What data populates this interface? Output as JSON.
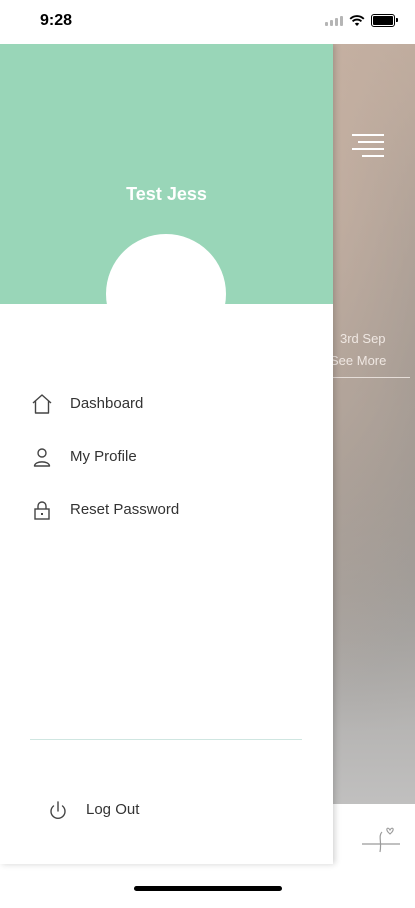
{
  "status_bar": {
    "time": "9:28"
  },
  "drawer": {
    "user_name": "Test Jess",
    "menu_items": [
      {
        "label": "Dashboard",
        "icon": "home-icon"
      },
      {
        "label": "My Profile",
        "icon": "user-icon"
      },
      {
        "label": "Reset Password",
        "icon": "lock-icon"
      }
    ],
    "logout_label": "Log Out",
    "header_color": "#99d6b8"
  },
  "background": {
    "date_text": "3rd Sep",
    "see_more": "See More"
  }
}
